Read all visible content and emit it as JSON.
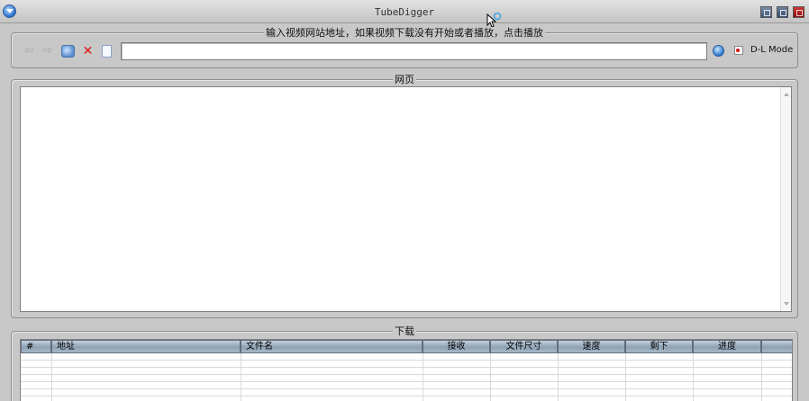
{
  "window": {
    "title": "TubeDigger"
  },
  "url_bar": {
    "group_title": "输入视频网站地址，如果视频下载没有开始或者播放，点击播放",
    "url_value": "",
    "dl_mode_label": "D-L Mode"
  },
  "web_panel": {
    "group_title": "网页"
  },
  "download_panel": {
    "group_title": "下载",
    "columns": [
      "#",
      "地址",
      "文件名",
      "接收",
      "文件尺寸",
      "速度",
      "剩下",
      "进度",
      ""
    ],
    "rows": []
  },
  "icons": {
    "back": "back-arrow-icon",
    "forward": "forward-arrow-icon",
    "refresh": "refresh-icon",
    "stop": "stop-icon",
    "page": "blank-page-icon",
    "go": "go-icon",
    "record": "record-icon"
  },
  "colors": {
    "window_bg": "#c8c8c8",
    "header_blue": "#8ea2b5",
    "close_red": "#b01818"
  }
}
